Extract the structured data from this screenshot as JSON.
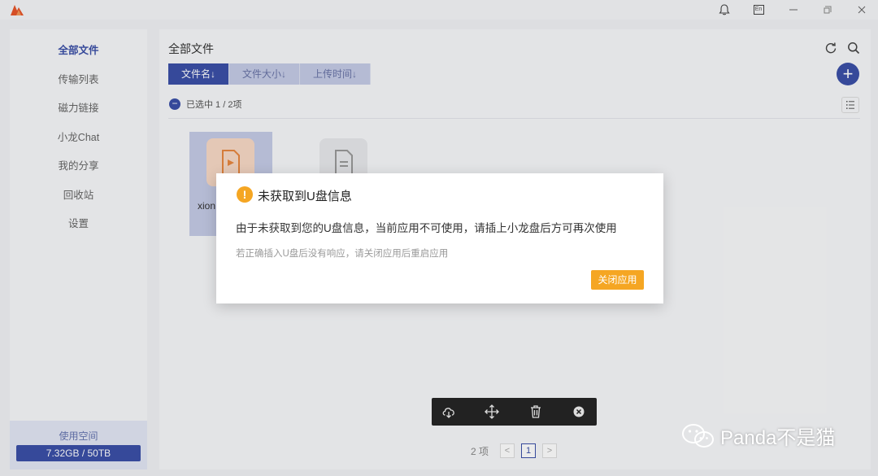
{
  "titlebar": {
    "lang_label": "En"
  },
  "sidebar": {
    "items": [
      {
        "label": "全部文件",
        "active": true
      },
      {
        "label": "传输列表"
      },
      {
        "label": "磁力链接"
      },
      {
        "label": "小龙Chat"
      },
      {
        "label": "我的分享"
      },
      {
        "label": "回收站"
      },
      {
        "label": "设置"
      }
    ],
    "usage_label": "使用空间",
    "usage_value": "7.32GB / 50TB"
  },
  "main": {
    "title": "全部文件",
    "sort_buttons": [
      {
        "label": "文件名↓",
        "active": true
      },
      {
        "label": "文件大小↓"
      },
      {
        "label": "上传时间↓"
      }
    ],
    "selected_text": "已选中 1 / 2项",
    "files": [
      {
        "name": "xion",
        "type": "video",
        "selected": true,
        "color": "#f8d9c6"
      },
      {
        "name": "",
        "type": "document",
        "selected": false,
        "color": "#e8e9ec"
      }
    ]
  },
  "pager": {
    "count_text": "2 项",
    "prev": "<",
    "current": "1",
    "next": ">"
  },
  "action_bar": {
    "icons": [
      "download-icon",
      "move-icon",
      "delete-icon",
      "close-icon"
    ]
  },
  "dialog": {
    "title": "未获取到U盘信息",
    "message": "由于未获取到您的U盘信息，当前应用不可使用，请插上小龙盘后方可再次使用",
    "hint": "若正确插入U盘后没有响应，请关闭应用后重启应用",
    "button_label": "关闭应用",
    "accent": "#f5a623"
  },
  "watermark": {
    "text": "Panda不是猫"
  },
  "colors": {
    "primary": "#3b50a8",
    "warning": "#f5a623"
  }
}
